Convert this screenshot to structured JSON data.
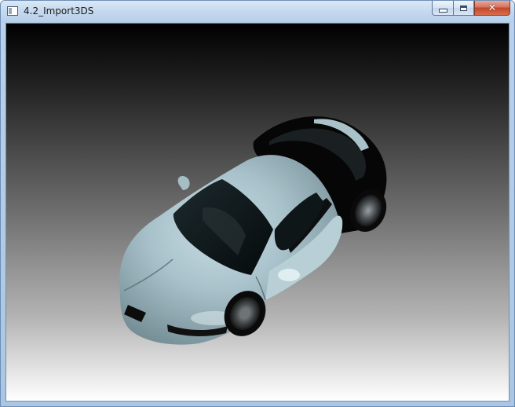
{
  "window": {
    "title": "4.2_Import3DS",
    "icon": "application-window-icon",
    "buttons": {
      "minimize": "minimize-icon",
      "maximize": "maximize-icon",
      "close": "close-icon",
      "close_glyph": "✕"
    }
  },
  "viewport": {
    "background_top": "#000000",
    "background_bottom": "#ffffff",
    "model": {
      "kind": "3d-car-model",
      "body_color": "#9fbac4",
      "glass_color": "#0b1416",
      "roof_color": "#050505"
    }
  }
}
